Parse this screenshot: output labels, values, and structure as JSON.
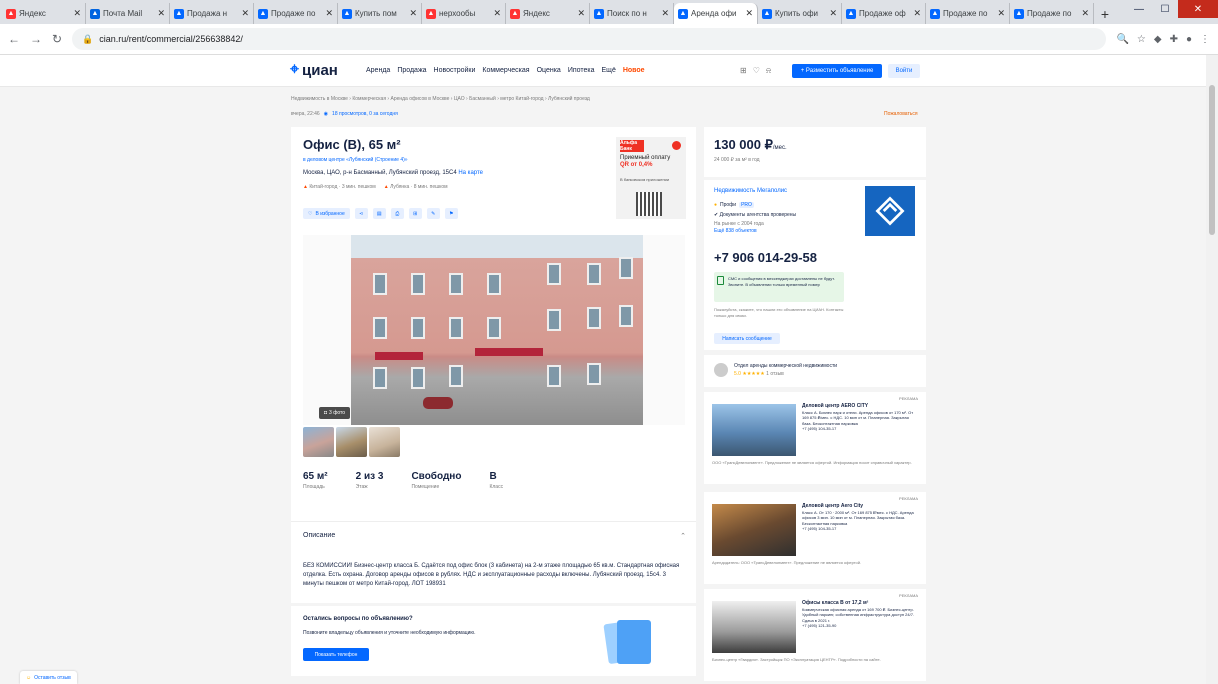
{
  "browser": {
    "tabs": [
      {
        "label": "Яндекс",
        "color": "#f33"
      },
      {
        "label": "Почта Mail",
        "color": "#0064e0"
      },
      {
        "label": "Продажа н",
        "color": "#0468ff"
      },
      {
        "label": "Продаже по",
        "color": "#0468ff"
      },
      {
        "label": "Купить пом",
        "color": "#0468ff"
      },
      {
        "label": "нерхообы",
        "color": "#f33"
      },
      {
        "label": "Яндекс",
        "color": "#f33"
      },
      {
        "label": "Поиск по н",
        "color": "#0468ff"
      },
      {
        "label": "Аренда офи",
        "color": "#0468ff",
        "active": true
      },
      {
        "label": "Купить офи",
        "color": "#0468ff"
      },
      {
        "label": "Продаже оф",
        "color": "#0468ff"
      },
      {
        "label": "Продаже по",
        "color": "#0468ff"
      },
      {
        "label": "Продаже по",
        "color": "#0468ff"
      }
    ],
    "url": "cian.ru/rent/commercial/256638842/"
  },
  "site": {
    "logo": "циан",
    "menu": [
      "Аренда",
      "Продажа",
      "Новостройки",
      "Коммерческая",
      "Оценка",
      "Ипотека",
      "Ещё",
      "Новое"
    ],
    "post_label": "+ Разместить объявление",
    "login_label": "Войти"
  },
  "breadcrumb": "Недвижимость в Москве › Коммерческая › Аренда офисов в Москве › ЦАО › Басманный › метро Китай-город › Лубянский проезд",
  "meta": {
    "date": "вчера, 22:46",
    "views": "18 просмотров, 0 за сегодня",
    "report": "Пожаловаться"
  },
  "listing": {
    "title": "Офис (B), 65 м²",
    "center_link": "в деловом центре «Лубянский (Строение 4)»",
    "address": "Москва, ЦАО, р-н Басманный, Лубянский проезд, 15С4",
    "map_link": "На карте",
    "metro1": "Китай-город · 3 мин. пешком",
    "metro2": "Лубянка · 8 мин. пешком",
    "fav_label": "В избранное",
    "photo_count": "3 фото",
    "facts": [
      {
        "value": "65 м²",
        "label": "Площадь"
      },
      {
        "value": "2 из 3",
        "label": "Этаж"
      },
      {
        "value": "Свободно",
        "label": "Помещение"
      },
      {
        "value": "B",
        "label": "Класс"
      }
    ],
    "desc_header": "Описание",
    "description": "БЕЗ КОМИССИИ! Бизнес-центр класса Б. Сдаётся под офис блок (3 кабинета) на 2-м этаже площадью 65 кв.м. Стандартная офисная отделка. Есть охрана. Договор аренды офисов в рублях. НДС и эксплуатационные расходы включены. Лубянский проезд, 15с4. 3 минуты пешком от метро Китай-город. ЛОТ 198931"
  },
  "ad": {
    "brand": "Альфа Банк",
    "text1": "Приемный оплату",
    "text2": "QR от 0,4%",
    "small": "В банковском приложении"
  },
  "questions": {
    "title": "Остались вопросы по объявлению?",
    "text": "Позвоните владельцу объявления и уточните необходимую информацию.",
    "button": "Показать телефон"
  },
  "sidebar": {
    "price": "130 000 ₽",
    "price_unit": "/мес.",
    "ppm": "24 000 ₽ за м² в год",
    "agent_name": "Недвижимость Мегаполис",
    "pro": "Профи",
    "pro_tag": "PRO",
    "docs": "Документы агентства проверены",
    "since": "На рынке с 2004 года",
    "objects": "Ещё 838 объектов",
    "phone": "+7 906 014-29-58",
    "notice": "СМС и сообщения в мессенджерах доставлены не будут. Звоните. В объявлении только временный номер",
    "fine": "Пожалуйста, скажите, что нашли это объявление на ЦИАН. Контакты только для связи.",
    "show_messages": "Написать сообщение",
    "dept_name": "Отдел аренды коммерческой недвижимости",
    "dept_rating": "5.0 ★★★★★",
    "dept_reviews": "1 отзыв"
  },
  "ads": [
    {
      "label": "РЕКЛАМА",
      "title": "Деловой центр AERO CITY",
      "text": "Класс А. Бизнес парк и отели. Аренда офисов от 170 м². От 169 875 ₽/мес. с НДС. 10 мин от м. Планерная. Закрытая база. Бесконтактная парковка",
      "phone": "+7 (495) 104-35-17",
      "foot": "ООО «ТрансДевелопмент». Предложение не является офертой. Информация носит справочный характер."
    },
    {
      "label": "РЕКЛАМА",
      "title": "Деловой центр Aero City",
      "text": "Класс А. От 170 · 2000 м². От 169 875 ₽/мес. с НДС. Аренда офисов 3 мин. 10 мин от м. Планерная. Закрытая база. Бесконтактная парковка",
      "phone": "+7 (495) 104-35-17",
      "foot": "Арендодатель: ООО «ТрансДевелопмент». Предложение не является офертой."
    },
    {
      "label": "РЕКЛАМА",
      "title": "Офисы класса В от 17,2 м²",
      "text": "Коммерческая офисная аренда от 169 700 ₽. Бизнес-центр. Удобный паркинг, собственная инфраструктура доступ 24/7. Сдача в 2021 г.",
      "phone": "+7 (495) 121-35-90",
      "foot": "Бизнес-центр «Гвардия». Застройщик ПО «Эксплуатация ЦЕНТР». Подробности на сайте."
    }
  ],
  "feedback": "Оставить отзыв",
  "colors": {
    "accent": "#0468ff",
    "brand_text": "#152242",
    "new": "#ff4900"
  }
}
